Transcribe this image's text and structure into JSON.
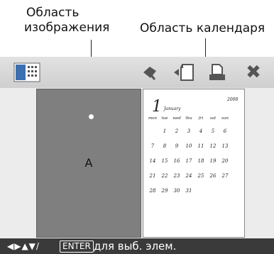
{
  "callouts": {
    "image_area_line1": "Область",
    "image_area_line2": "изображения",
    "calendar_area": "Область календаря"
  },
  "toolbar": {
    "icons": [
      "layout-icon",
      "eraser-icon",
      "insert-image-icon",
      "print-icon",
      "close-icon"
    ],
    "close_glyph": "✖"
  },
  "image_area": {
    "label": "A"
  },
  "calendar": {
    "month_number": "1",
    "month_name": "January",
    "year": "2008",
    "weekdays": [
      "mon",
      "tue",
      "wed",
      "thu",
      "fri",
      "sat",
      "sun"
    ],
    "weeks": [
      [
        "",
        "1",
        "2",
        "3",
        "4",
        "5",
        "6"
      ],
      [
        "7",
        "8",
        "9",
        "10",
        "11",
        "12",
        "13"
      ],
      [
        "14",
        "15",
        "16",
        "17",
        "18",
        "19",
        "20"
      ],
      [
        "21",
        "22",
        "23",
        "24",
        "25",
        "26",
        "27"
      ],
      [
        "28",
        "29",
        "30",
        "31",
        "",
        "",
        ""
      ]
    ]
  },
  "statusbar": {
    "nav_arrows": "◀▶▲▼/",
    "enter_key": "ENTER",
    "text": "для выб. элем."
  }
}
